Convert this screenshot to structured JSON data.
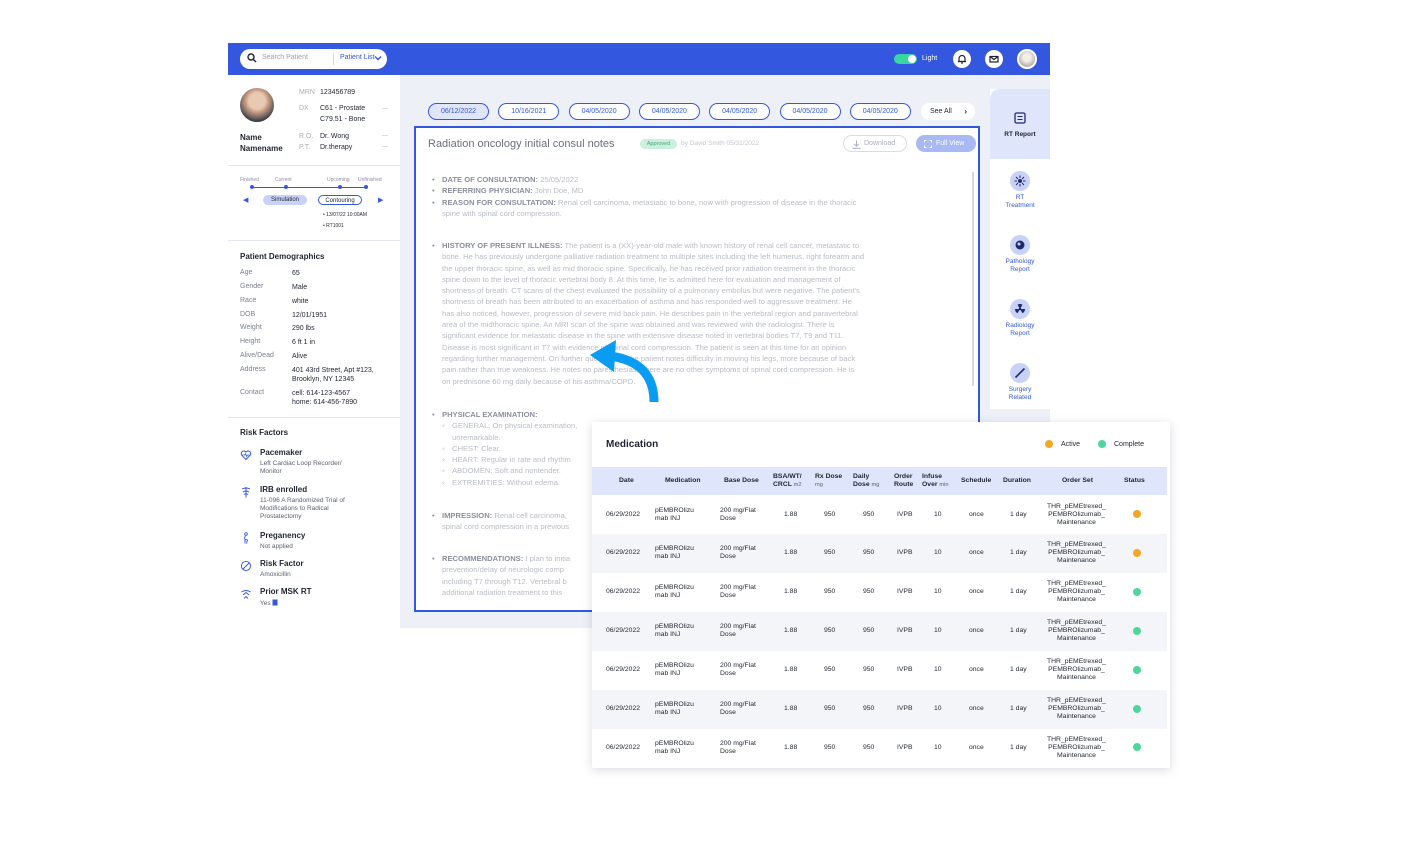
{
  "topbar": {
    "search_placeholder": "Search Patient",
    "patient_list": "Patient List",
    "theme_label": "Light"
  },
  "patient": {
    "mrn_label": "MRN",
    "mrn": "123456789",
    "dx_label": "DX",
    "dx1": "C61 - Prostate",
    "dx2": "C79.51 - Bone",
    "name_label": "Name",
    "name_value": "Namename",
    "ro_label": "R.O.",
    "ro": "Dr. Wong",
    "pt_label": "P.T.",
    "pt": "Dr.therapy",
    "more": "..."
  },
  "timeline": {
    "finished": "Finished",
    "current": "Current",
    "upcoming": "Upcoming",
    "unfinished": "Unfinished",
    "step1": "Simulation",
    "step2": "Contouring",
    "date": "13/07/22 10:00AM",
    "code": "RT1001"
  },
  "demographics": {
    "title": "Patient Demographics",
    "rows": [
      {
        "k": "Age",
        "v": "65"
      },
      {
        "k": "Gender",
        "v": "Male"
      },
      {
        "k": "Race",
        "v": "white"
      },
      {
        "k": "DOB",
        "v": "12/01/1951"
      },
      {
        "k": "Weight",
        "v": "290 lbs"
      },
      {
        "k": "Height",
        "v": "6 ft 1 in"
      },
      {
        "k": "Alive/Dead",
        "v": "Alive"
      },
      {
        "k": "Address",
        "v": "401 43rd Street, Apt #123,",
        "v2": "Brooklyn, NY 12345"
      },
      {
        "k": "Contact",
        "v": "cell: 614-123-4567",
        "v2": "home: 614-456-7890"
      }
    ]
  },
  "risk": {
    "title": "Risk Factors",
    "items": [
      {
        "title": "Pacemaker",
        "sub1": "Left Cardiac Loop Recorder/",
        "sub2": "Monitor",
        "sub3": ""
      },
      {
        "title": "IRB enrolled",
        "sub1": "11-096  A Randomized Trial of",
        "sub2": "Modifications to Radical",
        "sub3": "Prostatectomy"
      },
      {
        "title": "Preganency",
        "sub1": "Not applied",
        "sub2": "",
        "sub3": ""
      },
      {
        "title": "Risk Factor",
        "sub1": "Amoxicillin",
        "sub2": "",
        "sub3": ""
      },
      {
        "title": "Prior MSK RT",
        "sub1": "Yes",
        "sub2": "",
        "sub3": ""
      }
    ]
  },
  "dates": [
    "06/12/2022",
    "10/16/2021",
    "04/05/2020",
    "04/05/2020",
    "04/05/2020",
    "04/05/2020",
    "04/05/2020"
  ],
  "see_all": "See All",
  "notes": {
    "title": "Radiation oncology initial consul notes",
    "status": "Approved",
    "by": "by David Smith 05/31/2022",
    "download": "Download",
    "full_view": "Full View",
    "l1k": "DATE OF CONSULTATION:",
    "l1v": "25/05/2022",
    "l2k": "REFERRING PHYSICIAN:",
    "l2v": "John Doe, MD",
    "l3k": "REASON FOR CONSULTATION:",
    "l3v": "Renal cell carcinoma, metastatic to bone, now with progression of disease in the thoracic",
    "l3c": "spine with spinal cord compression.",
    "hpi_k": "HISTORY OF PRESENT ILLNESS:",
    "hpi": [
      "The patient is a (XX)-year-old male with known history of renal cell cancer, metastatic to",
      "bone.  He has previously undergone palliative radiation treatment to multiple sites including the left humerus, right forearm and",
      "the upper thoracic spine, as well as mid thoracic spine.  Specifically, he has received prior radiation treatment in the thoracic",
      "spine down to the level of thoracic vertebral body 8.  At this time, he is admitted here for evaluation and management of",
      "shortness of breath.  CT scans of the chest evaluated the possibility of a pulmonary embolus but were negative.  The patient's",
      "shortness of breath has been attributed to an exacerbation of asthma and has responded well to aggressive treatment.  He",
      "has also noticed, however, progression of severe mid back pain.  He describes pain in the vertebral region and paravertebral",
      "area of the midthoracic spine.  An MRI scan of the spine was obtained and was reviewed with the radiologist.  There is",
      "significant evidence for metastatic disease in the spine with extensive disease noted in vertebral bodies T7, T9 and T11.",
      "Disease is most significant in T7 with evidence of spinal cord compression.  The patient is seen at this time for an opinion",
      "regarding further management.  On further questioning, the patient notes difficulty in moving his legs, more because of back",
      "pain rather than true weakness.  He notes no paresthesias.  There are no other symptoms of spinal cord compression.  He is",
      "on prednisone 60 mg daily because of his asthma/COPD."
    ],
    "pe_k": "PHYSICAL EXAMINATION:",
    "pe": [
      "GENERAL:  On physical examination,",
      "unremarkable.",
      "CHEST:  Clear.",
      "HEART:  Regular in rate and rhythm",
      "ABDOMEN:  Soft and nontender.",
      "EXTREMITIES:  Without edema."
    ],
    "imp_k": "IMPRESSION:",
    "imp1": "Renal cell carcinoma,",
    "imp2": "spinal cord compression in a previous",
    "rec_k": "RECOMMENDATIONS:",
    "rec1": "I plan to initia",
    "rec2": "prevention/delay of neurologic comp",
    "rec3": "including T7 through T12.  Vertebral b",
    "rec4": "additional radiation treatment to this"
  },
  "rail": {
    "rt_report": "RT Report",
    "rt_treatment_1": "RT",
    "rt_treatment_2": "Treatment",
    "pathology_1": "Pathology",
    "pathology_2": "Report",
    "radiology_1": "Radiology",
    "radiology_2": "Report",
    "surgery_1": "Surgery",
    "surgery_2": "Related"
  },
  "medication": {
    "title": "Medication",
    "legend_active": "Active",
    "legend_complete": "Complete",
    "colors": {
      "active": "#f5a623",
      "complete": "#4fd79a"
    },
    "headers": {
      "date": "Date",
      "medication": "Medication",
      "base_dose": "Base Dose",
      "bsa1": "BSA/WT/",
      "bsa2": "CRCL",
      "bsa_unit": "m2",
      "rx1": "Rx Dose",
      "rx_unit": "mg",
      "daily1": "Daily",
      "daily2": "Dose",
      "daily_unit": "mg",
      "order1": "Order",
      "order2": "Route",
      "infuse1": "Infuse",
      "infuse2": "Over",
      "infuse_unit": "min",
      "schedule": "Schedule",
      "duration": "Duration",
      "order_set": "Order Set",
      "status": "Status"
    },
    "rows": [
      {
        "date": "06/29/2022",
        "med1": "pEMBROlizu",
        "med2": "mab INJ",
        "dose1": "200 mg/Flat",
        "dose2": "Dose",
        "bsa": "1.88",
        "rx": "950",
        "daily": "950",
        "route": "IVPB",
        "infuse": "10",
        "schedule": "once",
        "duration": "1 day",
        "os1": "THR_pEMEtrexed_",
        "os2": "PEMBROlizumab_",
        "os3": "Maintenance",
        "status": "active"
      },
      {
        "date": "06/29/2022",
        "med1": "pEMBROlizu",
        "med2": "mab INJ",
        "dose1": "200 mg/Flat",
        "dose2": "Dose",
        "bsa": "1.88",
        "rx": "950",
        "daily": "950",
        "route": "IVPB",
        "infuse": "10",
        "schedule": "once",
        "duration": "1 day",
        "os1": "THR_pEMEtrexed_",
        "os2": "PEMBROlizumab_",
        "os3": "Maintenance",
        "status": "active"
      },
      {
        "date": "06/29/2022",
        "med1": "pEMBROlizu",
        "med2": "mab INJ",
        "dose1": "200 mg/Flat",
        "dose2": "Dose",
        "bsa": "1.88",
        "rx": "950",
        "daily": "950",
        "route": "IVPB",
        "infuse": "10",
        "schedule": "once",
        "duration": "1 day",
        "os1": "THR_pEMEtrexed_",
        "os2": "PEMBROlizumab_",
        "os3": "Maintenance",
        "status": "complete"
      },
      {
        "date": "06/29/2022",
        "med1": "pEMBROlizu",
        "med2": "mab INJ",
        "dose1": "200 mg/Flat",
        "dose2": "Dose",
        "bsa": "1.88",
        "rx": "950",
        "daily": "950",
        "route": "IVPB",
        "infuse": "10",
        "schedule": "once",
        "duration": "1 day",
        "os1": "THR_pEMEtrexed_",
        "os2": "PEMBROlizumab_",
        "os3": "Maintenance",
        "status": "complete"
      },
      {
        "date": "06/29/2022",
        "med1": "pEMBROlizu",
        "med2": "mab INJ",
        "dose1": "200 mg/Flat",
        "dose2": "Dose",
        "bsa": "1.88",
        "rx": "950",
        "daily": "950",
        "route": "IVPB",
        "infuse": "10",
        "schedule": "once",
        "duration": "1 day",
        "os1": "THR_pEMEtrexed_",
        "os2": "PEMBROlizumab_",
        "os3": "Maintenance",
        "status": "complete"
      },
      {
        "date": "06/29/2022",
        "med1": "pEMBROlizu",
        "med2": "mab INJ",
        "dose1": "200 mg/Flat",
        "dose2": "Dose",
        "bsa": "1.88",
        "rx": "950",
        "daily": "950",
        "route": "IVPB",
        "infuse": "10",
        "schedule": "once",
        "duration": "1 day",
        "os1": "THR_pEMEtrexed_",
        "os2": "PEMBROlizumab_",
        "os3": "Maintenance",
        "status": "complete"
      },
      {
        "date": "06/29/2022",
        "med1": "pEMBROlizu",
        "med2": "mab INJ",
        "dose1": "200 mg/Flat",
        "dose2": "Dose",
        "bsa": "1.88",
        "rx": "950",
        "daily": "950",
        "route": "IVPB",
        "infuse": "10",
        "schedule": "once",
        "duration": "1 day",
        "os1": "THR_pEMEtrexed_",
        "os2": "PEMBROlizumab_",
        "os3": "Maintenance",
        "status": "complete"
      }
    ]
  }
}
